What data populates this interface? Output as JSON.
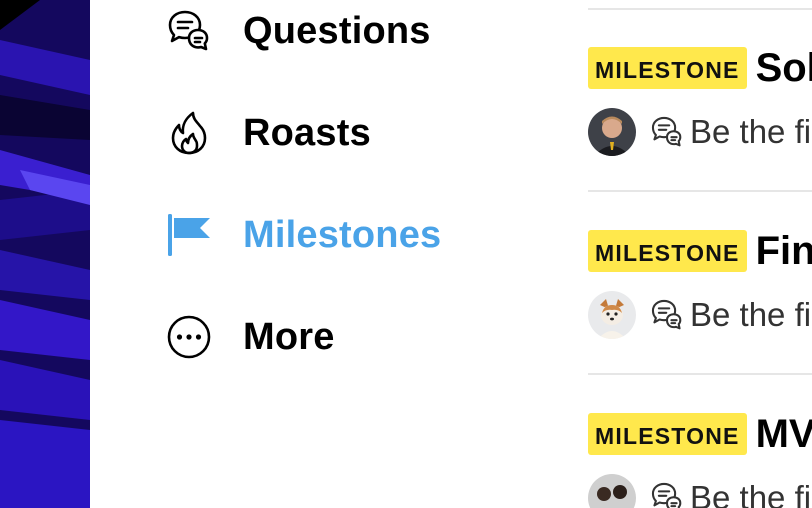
{
  "nav": {
    "items": [
      {
        "label": "Questions",
        "icon": "question-bubbles-icon"
      },
      {
        "label": "Roasts",
        "icon": "flame-icon"
      },
      {
        "label": "Milestones",
        "icon": "flag-icon",
        "active": true
      },
      {
        "label": "More",
        "icon": "ellipsis-circle-icon"
      }
    ]
  },
  "feed": {
    "posts": [
      {
        "badge": "MILESTONE",
        "title": "Sol",
        "comment_prompt": "Be the fi"
      },
      {
        "badge": "MILESTONE",
        "title": "Fini",
        "comment_prompt": "Be the fi"
      },
      {
        "badge": "MILESTONE",
        "title": "MV",
        "comment_prompt": "Be the fi"
      }
    ]
  },
  "colors": {
    "active": "#4aa3e8",
    "badge_bg": "#ffe84c",
    "strip_bg": "#1b0c7a"
  }
}
